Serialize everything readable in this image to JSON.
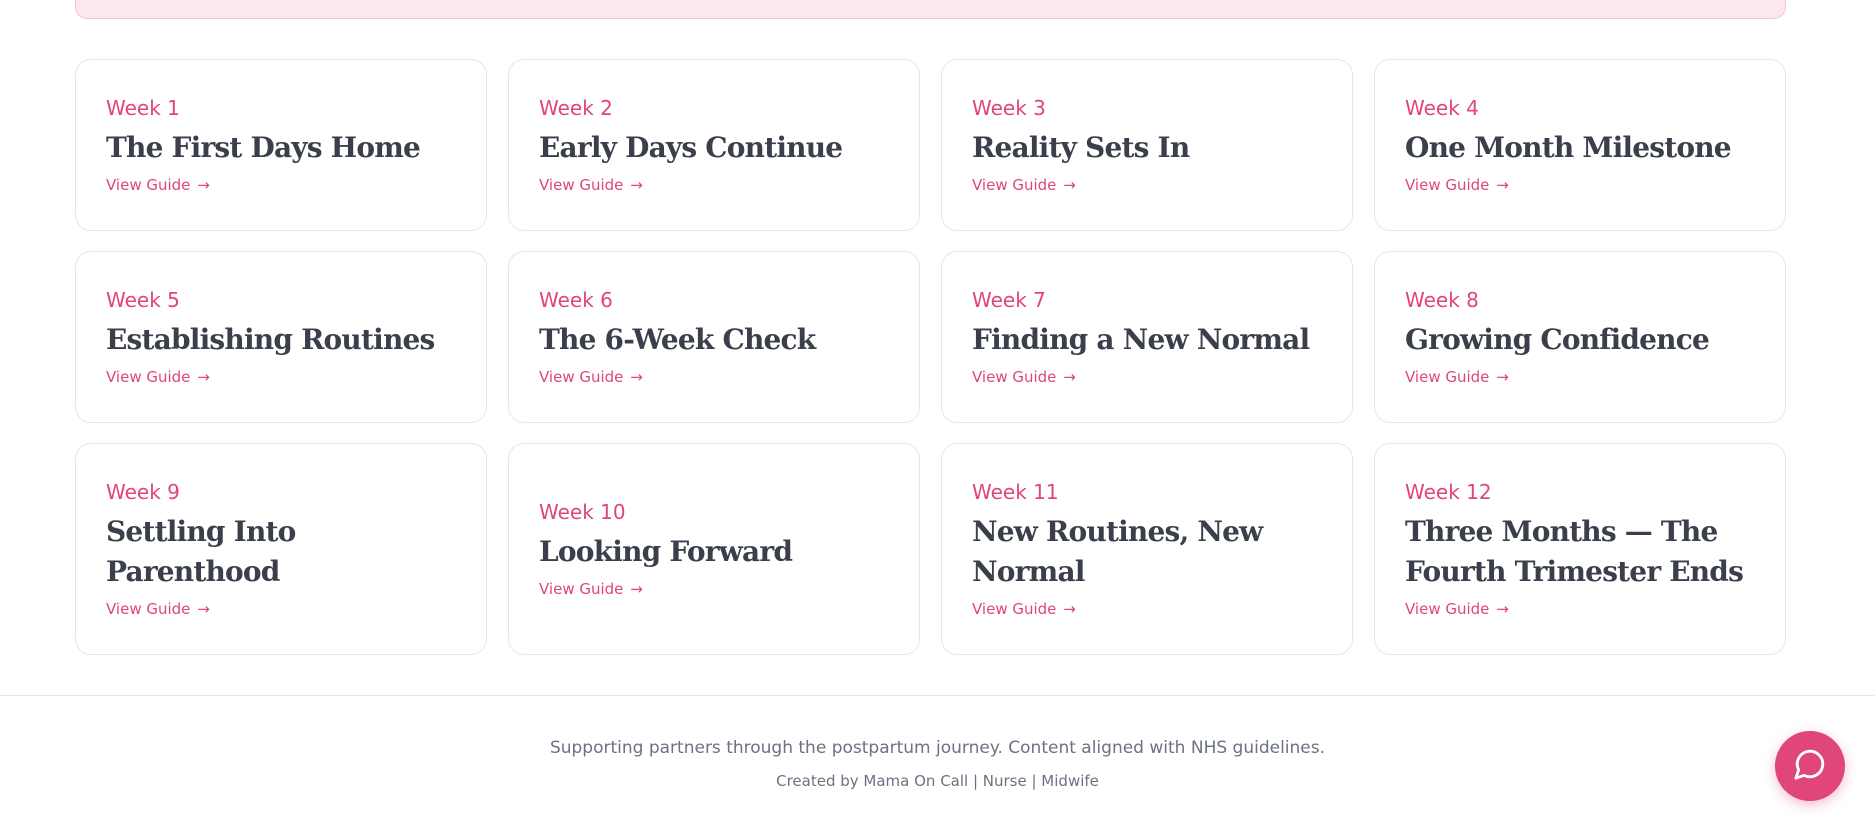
{
  "weeks": [
    {
      "week": "Week 1",
      "title": "The First Days Home",
      "link": "View Guide"
    },
    {
      "week": "Week 2",
      "title": "Early Days Continue",
      "link": "View Guide"
    },
    {
      "week": "Week 3",
      "title": "Reality Sets In",
      "link": "View Guide"
    },
    {
      "week": "Week 4",
      "title": "One Month Milestone",
      "link": "View Guide"
    },
    {
      "week": "Week 5",
      "title": "Establishing Routines",
      "link": "View Guide"
    },
    {
      "week": "Week 6",
      "title": "The 6-Week Check",
      "link": "View Guide"
    },
    {
      "week": "Week 7",
      "title": "Finding a New Normal",
      "link": "View Guide"
    },
    {
      "week": "Week 8",
      "title": "Growing Confidence",
      "link": "View Guide"
    },
    {
      "week": "Week 9",
      "title": "Settling Into Parenthood",
      "link": "View Guide"
    },
    {
      "week": "Week 10",
      "title": "Looking Forward",
      "link": "View Guide"
    },
    {
      "week": "Week 11",
      "title": "New Routines, New Normal",
      "link": "View Guide"
    },
    {
      "week": "Week 12",
      "title": "Three Months — The Fourth Trimester Ends",
      "link": "View Guide"
    }
  ],
  "link_arrow": "→",
  "footer": {
    "tagline": "Supporting partners through the postpartum journey. Content aligned with NHS guidelines.",
    "credit": "Created by Mama On Call | Nurse | Midwife"
  },
  "chat": {
    "icon": "chat-bubble-icon"
  },
  "colors": {
    "accent": "#e0457b",
    "heading": "#3a3f4b",
    "muted": "#6b7280",
    "banner": "#fce7ef"
  }
}
